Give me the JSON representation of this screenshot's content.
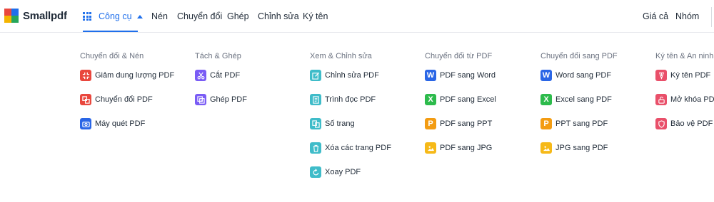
{
  "brand": {
    "name": "Smallpdf",
    "colors": [
      "#e9473d",
      "#1f6feb",
      "#f4b400",
      "#26a65b"
    ]
  },
  "nav": {
    "tools_label": "Công cụ",
    "links": [
      "Nén",
      "Chuyển đổi",
      "Ghép",
      "Chỉnh sửa",
      "Ký tên"
    ],
    "right_links": [
      "Giá cả",
      "Nhóm"
    ]
  },
  "colors": {
    "accent": "#1f6feb",
    "red": "#e9473d",
    "purple": "#7a5cf5",
    "teal": "#3fbcc9",
    "blue": "#2a66e6",
    "green": "#2dbb4c",
    "orange": "#f39c12",
    "yellow": "#f6b918",
    "rose": "#e9506a"
  },
  "menu": {
    "columns": [
      {
        "title": "Chuyển đổi & Nén",
        "items": [
          {
            "label": "Giảm dung lượng PDF",
            "icon": "compress-icon",
            "color": "#e9473d"
          },
          {
            "label": "Chuyển đổi PDF",
            "icon": "convert-icon",
            "color": "#e9473d"
          },
          {
            "label": "Máy quét PDF",
            "icon": "scanner-icon",
            "color": "#2a66e6"
          }
        ]
      },
      {
        "title": "Tách & Ghép",
        "items": [
          {
            "label": "Cắt PDF",
            "icon": "scissors-icon",
            "color": "#7a5cf5"
          },
          {
            "label": "Ghép PDF",
            "icon": "merge-icon",
            "color": "#7a5cf5"
          }
        ]
      },
      {
        "title": "Xem & Chỉnh sửa",
        "items": [
          {
            "label": "Chỉnh sửa PDF",
            "icon": "edit-icon",
            "color": "#3fbcc9"
          },
          {
            "label": "Trình đọc PDF",
            "icon": "reader-icon",
            "color": "#3fbcc9"
          },
          {
            "label": "Số trang",
            "icon": "page-number-icon",
            "color": "#3fbcc9"
          },
          {
            "label": "Xóa các trang PDF",
            "icon": "trash-icon",
            "color": "#3fbcc9"
          },
          {
            "label": "Xoay PDF",
            "icon": "rotate-icon",
            "color": "#3fbcc9"
          }
        ]
      },
      {
        "title": "Chuyển đổi từ PDF",
        "items": [
          {
            "label": "PDF sang Word",
            "icon": "word-icon",
            "color": "#2a66e6",
            "glyph": "W"
          },
          {
            "label": "PDF sang Excel",
            "icon": "excel-icon",
            "color": "#2dbb4c",
            "glyph": "X"
          },
          {
            "label": "PDF sang PPT",
            "icon": "ppt-icon",
            "color": "#f39c12",
            "glyph": "P"
          },
          {
            "label": "PDF sang JPG",
            "icon": "image-icon",
            "color": "#f6b918"
          }
        ]
      },
      {
        "title": "Chuyển đổi sang PDF",
        "items": [
          {
            "label": "Word sang PDF",
            "icon": "word-icon",
            "color": "#2a66e6",
            "glyph": "W"
          },
          {
            "label": "Excel sang PDF",
            "icon": "excel-icon",
            "color": "#2dbb4c",
            "glyph": "X"
          },
          {
            "label": "PPT sang PDF",
            "icon": "ppt-icon",
            "color": "#f39c12",
            "glyph": "P"
          },
          {
            "label": "JPG sang PDF",
            "icon": "image-icon",
            "color": "#f6b918"
          }
        ]
      },
      {
        "title": "Ký tên & An ninh",
        "items": [
          {
            "label": "Ký tên PDF",
            "icon": "sign-icon",
            "color": "#e9506a"
          },
          {
            "label": "Mở khóa PDF",
            "icon": "unlock-icon",
            "color": "#e9506a"
          },
          {
            "label": "Bảo vệ PDF",
            "icon": "shield-icon",
            "color": "#e9506a"
          }
        ]
      }
    ]
  }
}
